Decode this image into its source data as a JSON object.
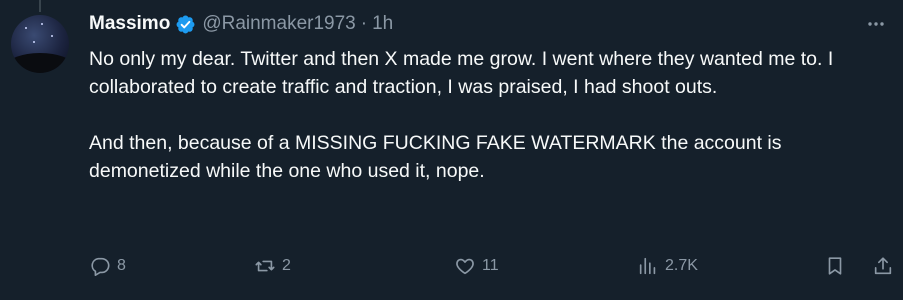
{
  "tweet": {
    "author_name": "Massimo",
    "handle": "@Rainmaker1973",
    "separator": "·",
    "time": "1h",
    "more_label": "···",
    "paragraphs": [
      "No only my dear. Twitter and then X made me grow. I went where they wanted me to. I collaborated to create traffic and traction, I was praised, I had shoot outs.",
      "And then, because of a MISSING FUCKING FAKE WATERMARK the account is demonetized while the one who used it, nope."
    ]
  },
  "actions": {
    "replies": "8",
    "reposts": "2",
    "likes": "11",
    "views": "2.7K"
  },
  "colors": {
    "background": "#15202b",
    "text": "#f7f9f9",
    "muted": "#8b98a5",
    "verified": "#1d9bf0"
  },
  "icons": [
    "verified-badge-icon",
    "more-icon",
    "reply-icon",
    "repost-icon",
    "like-icon",
    "views-icon",
    "bookmark-icon",
    "share-icon"
  ]
}
